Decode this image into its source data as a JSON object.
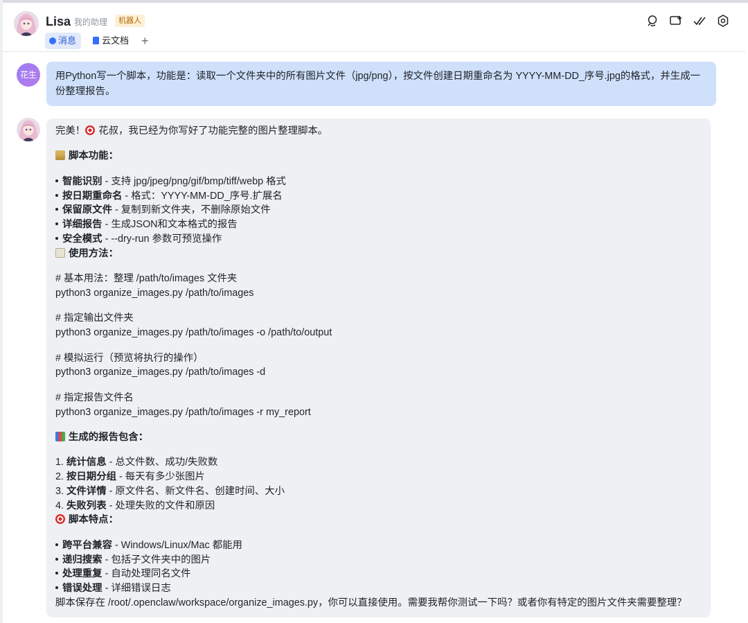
{
  "header": {
    "name": "Lisa",
    "subtitle": "我的助理",
    "badge": "机器人",
    "tabs": [
      {
        "label": "消息",
        "active": true
      },
      {
        "label": "云文档",
        "active": false
      }
    ],
    "add_tab_symbol": "+",
    "actions": [
      "search-chat-icon",
      "add-window-icon",
      "done-check-icon",
      "settings-gear-icon"
    ]
  },
  "user_message": {
    "avatar_text": "花生",
    "text": "用Python写一个脚本，功能是：读取一个文件夹中的所有图片文件（jpg/png），按文件创建日期重命名为 YYYY-MM-DD_序号.jpg的格式，并生成一份整理报告。"
  },
  "bot_message": {
    "intro_a": "完美！",
    "intro_b": "花叔，我已经为你写好了功能完整的图片整理脚本。",
    "features_title": "脚本功能：",
    "features": [
      {
        "term": "智能识别",
        "desc": " - 支持 jpg/jpeg/png/gif/bmp/tiff/webp 格式"
      },
      {
        "term": "按日期重命名",
        "desc": " - 格式：YYYY-MM-DD_序号.扩展名"
      },
      {
        "term": "保留原文件",
        "desc": " - 复制到新文件夹，不删除原始文件"
      },
      {
        "term": "详细报告",
        "desc": " - 生成JSON和文本格式的报告"
      },
      {
        "term": "安全模式",
        "desc": " - --dry-run 参数可预览操作"
      }
    ],
    "usage_title": "使用方法：",
    "usage": [
      {
        "comment": "# 基本用法：整理 /path/to/images 文件夹",
        "cmd": "python3 organize_images.py /path/to/images"
      },
      {
        "comment": "# 指定输出文件夹",
        "cmd": "python3 organize_images.py /path/to/images -o /path/to/output"
      },
      {
        "comment": "# 模拟运行（预览将执行的操作）",
        "cmd": "python3 organize_images.py /path/to/images -d"
      },
      {
        "comment": "# 指定报告文件名",
        "cmd": "python3 organize_images.py /path/to/images -r my_report"
      }
    ],
    "report_title": "生成的报告包含：",
    "report_items": [
      {
        "num": "1.",
        "term": "统计信息",
        "desc": " - 总文件数、成功/失败数"
      },
      {
        "num": "2.",
        "term": "按日期分组",
        "desc": " - 每天有多少张图片"
      },
      {
        "num": "3.",
        "term": "文件详情",
        "desc": " - 原文件名、新文件名、创建时间、大小"
      },
      {
        "num": "4.",
        "term": "失败列表",
        "desc": " - 处理失败的文件和原因"
      }
    ],
    "traits_title": "脚本特点：",
    "traits": [
      {
        "term": "跨平台兼容",
        "desc": " - Windows/Linux/Mac 都能用"
      },
      {
        "term": "递归搜索",
        "desc": " - 包括子文件夹中的图片"
      },
      {
        "term": "处理重复",
        "desc": " - 自动处理同名文件"
      },
      {
        "term": "错误处理",
        "desc": " - 详细错误日志"
      }
    ],
    "closing": "脚本保存在 /root/.openclaw/workspace/organize_images.py，你可以直接使用。需要我帮你测试一下吗？或者你有特定的图片文件夹需要整理？"
  },
  "colors": {
    "user_bubble": "#cfe0fb",
    "bot_bubble": "#eef0f3",
    "accent": "#3370ff",
    "badge_bg": "#fdf0d5"
  }
}
